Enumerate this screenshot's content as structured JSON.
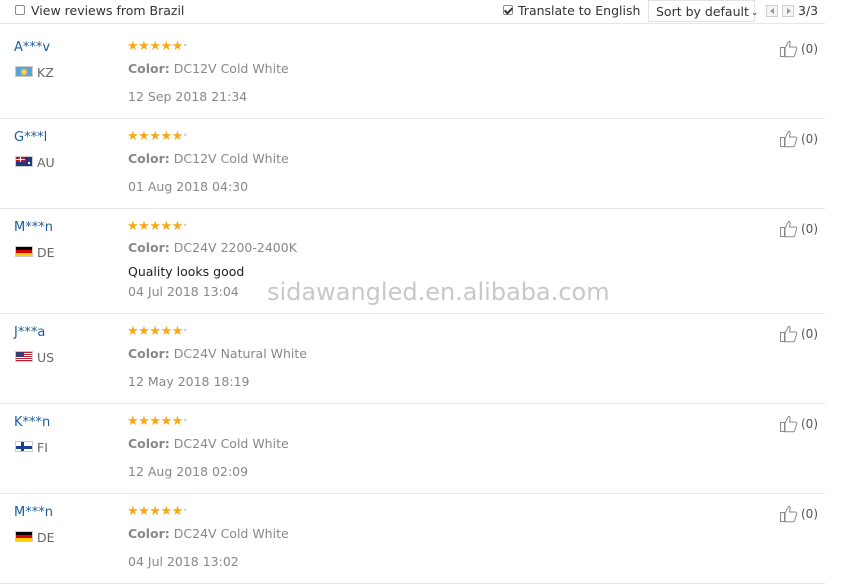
{
  "toolbar": {
    "view_brazil_label": "View reviews from Brazil",
    "view_brazil_checked": false,
    "translate_label": "Translate to English",
    "translate_checked": true,
    "sort_label": "Sort by default",
    "page_indicator": "3/3"
  },
  "reviews": [
    {
      "user": "A***v",
      "flag": "kz",
      "country": "KZ",
      "rating": 5,
      "color_label": "Color:",
      "color_value": "DC12V Cold White",
      "comment": "",
      "date": "12 Sep 2018 21:34",
      "likes": "(0)"
    },
    {
      "user": "G***l",
      "flag": "au",
      "country": "AU",
      "rating": 5,
      "color_label": "Color:",
      "color_value": "DC12V Cold White",
      "comment": "",
      "date": "01 Aug 2018 04:30",
      "likes": "(0)"
    },
    {
      "user": "M***n",
      "flag": "de",
      "country": "DE",
      "rating": 5,
      "color_label": "Color:",
      "color_value": "DC24V 2200-2400K",
      "comment": "Quality looks good",
      "date": "04 Jul 2018 13:04",
      "likes": "(0)"
    },
    {
      "user": "J***a",
      "flag": "us",
      "country": "US",
      "rating": 5,
      "color_label": "Color:",
      "color_value": "DC24V Natural White",
      "comment": "",
      "date": "12 May 2018 18:19",
      "likes": "(0)"
    },
    {
      "user": "K***n",
      "flag": "fi",
      "country": "FI",
      "rating": 5,
      "color_label": "Color:",
      "color_value": "DC24V Cold White",
      "comment": "",
      "date": "12 Aug 2018 02:09",
      "likes": "(0)"
    },
    {
      "user": "M***n",
      "flag": "de",
      "country": "DE",
      "rating": 5,
      "color_label": "Color:",
      "color_value": "DC24V Cold White",
      "comment": "",
      "date": "04 Jul 2018 13:02",
      "likes": "(0)"
    }
  ],
  "watermark": "sidawangled.en.alibaba.com",
  "colors": {
    "username": "#1d5c9b",
    "star": "#f7a814",
    "muted": "#888888"
  }
}
